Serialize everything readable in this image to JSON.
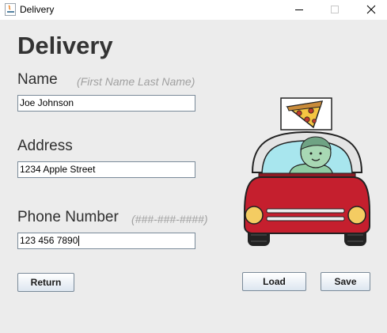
{
  "window": {
    "title": "Delivery"
  },
  "form": {
    "heading": "Delivery",
    "name_label": "Name",
    "name_hint": "(First Name Last Name)",
    "name_value": "Joe Johnson",
    "address_label": "Address",
    "address_value": "1234 Apple Street",
    "phone_label": "Phone Number",
    "phone_hint": "(###-###-####)",
    "phone_value": "123 456 7890"
  },
  "buttons": {
    "return_label": "Return",
    "load_label": "Load",
    "save_label": "Save"
  },
  "illustration": {
    "icon": "pizza-delivery-car-icon"
  }
}
